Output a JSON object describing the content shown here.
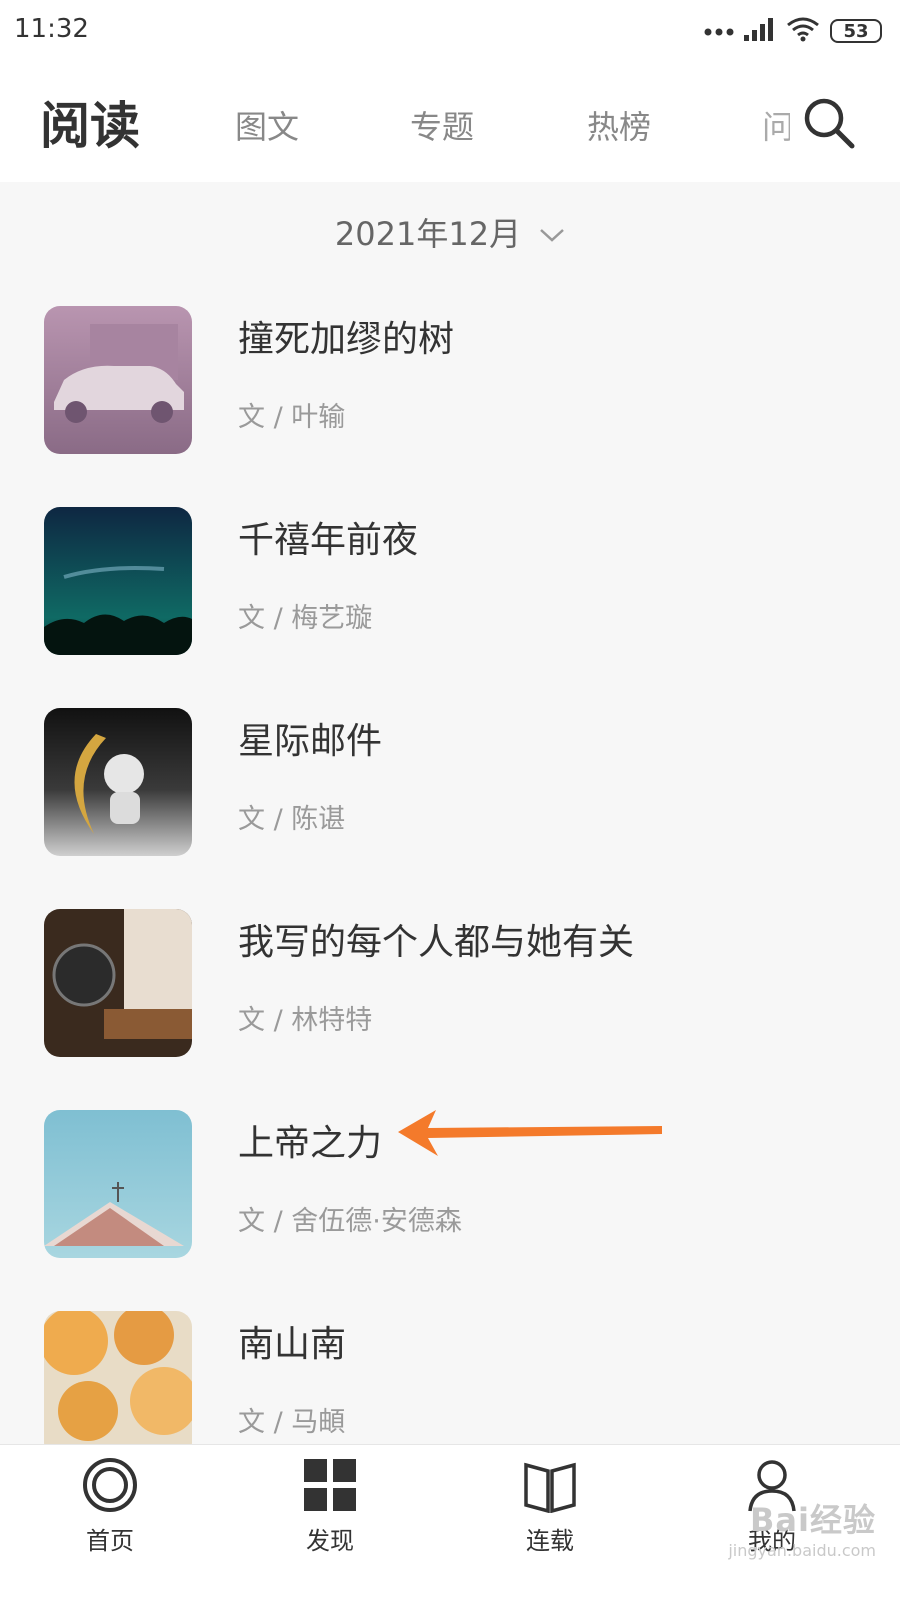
{
  "status_bar": {
    "time": "11:32",
    "battery": "53"
  },
  "header": {
    "title": "阅读",
    "tabs": [
      {
        "label": "图文"
      },
      {
        "label": "专题"
      },
      {
        "label": "热榜"
      },
      {
        "label": "问"
      }
    ]
  },
  "date_filter": {
    "label": "2021年12月"
  },
  "articles": [
    {
      "title": "撞死加缪的树",
      "author": "文 / 叶输",
      "thumb_colors": [
        "#b995b0",
        "#8a6b86"
      ]
    },
    {
      "title": "千禧年前夜",
      "author": "文 / 梅艺璇",
      "thumb_colors": [
        "#0e2742",
        "#0f6a64"
      ]
    },
    {
      "title": "星际邮件",
      "author": "文 / 陈谌",
      "thumb_colors": [
        "#111111",
        "#cfcfcf"
      ]
    },
    {
      "title": "我写的每个人都与她有关",
      "author": "文 / 林特特",
      "thumb_colors": [
        "#3a2a1e",
        "#d3b58c"
      ]
    },
    {
      "title": "上帝之力",
      "author": "文 / 舍伍德·安德森",
      "thumb_colors": [
        "#86c4d6",
        "#c38b7f"
      ]
    },
    {
      "title": "南山南",
      "author": "文 / 马頔",
      "thumb_colors": [
        "#f0a540",
        "#e8dcc6"
      ]
    }
  ],
  "annotation": {
    "arrow_color": "#f47a2b"
  },
  "bottom_nav": [
    {
      "label": "首页"
    },
    {
      "label": "发现"
    },
    {
      "label": "连载"
    },
    {
      "label": "我的"
    }
  ],
  "watermark": {
    "logo": "Bai经验",
    "url": "jingyan.baidu.com"
  }
}
